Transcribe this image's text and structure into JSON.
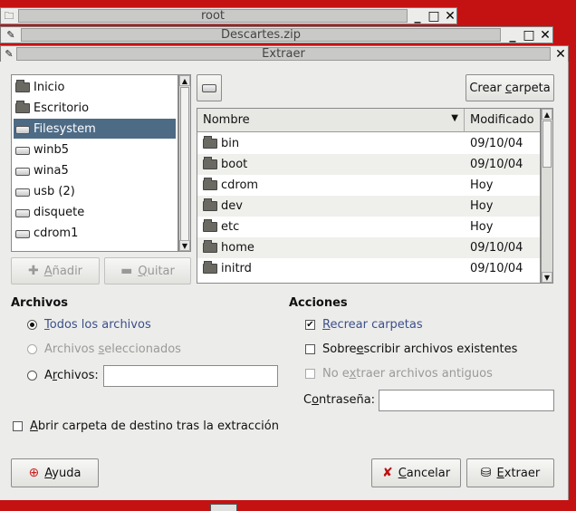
{
  "windows": [
    {
      "icon": "folder-icon",
      "title": "root"
    },
    {
      "icon": "archive-icon",
      "title": "Descartes.zip"
    },
    {
      "icon": "archive-icon",
      "title": "Extraer"
    }
  ],
  "places": {
    "items": [
      {
        "label": "Inicio",
        "icon": "home-folder-icon"
      },
      {
        "label": "Escritorio",
        "icon": "desktop-icon"
      },
      {
        "label": "Filesystem",
        "icon": "drive-icon",
        "selected": true
      },
      {
        "label": "winb5",
        "icon": "drive-icon"
      },
      {
        "label": "wina5",
        "icon": "drive-icon"
      },
      {
        "label": "usb (2)",
        "icon": "drive-icon"
      },
      {
        "label": "disquete",
        "icon": "drive-icon"
      },
      {
        "label": "cdrom1",
        "icon": "drive-icon"
      }
    ],
    "add_label_pre": "",
    "add_label_u": "A",
    "add_label_post": "ñadir",
    "remove_label_pre": "",
    "remove_label_u": "Q",
    "remove_label_post": "uitar"
  },
  "browser": {
    "create_folder_pre": "Crear ",
    "create_folder_u": "c",
    "create_folder_post": "arpeta",
    "columns": {
      "name": "Nombre",
      "modified": "Modificado"
    },
    "rows": [
      {
        "name": "bin",
        "modified": "09/10/04"
      },
      {
        "name": "boot",
        "modified": "09/10/04"
      },
      {
        "name": "cdrom",
        "modified": "Hoy"
      },
      {
        "name": "dev",
        "modified": "Hoy"
      },
      {
        "name": "etc",
        "modified": "Hoy"
      },
      {
        "name": "home",
        "modified": "09/10/04"
      },
      {
        "name": "initrd",
        "modified": "09/10/04"
      }
    ]
  },
  "files": {
    "title": "Archivos",
    "all_pre": "",
    "all_u": "T",
    "all_post": "odos los archivos",
    "selected_pre": "Archivos ",
    "selected_u": "s",
    "selected_post": "eleccionados",
    "pattern_pre": "A",
    "pattern_u": "r",
    "pattern_post": "chivos:",
    "pattern_value": ""
  },
  "actions": {
    "title": "Acciones",
    "recreate_pre": "",
    "recreate_u": "R",
    "recreate_post": "ecrear carpetas",
    "overwrite_pre": "Sobre",
    "overwrite_u": "e",
    "overwrite_post": "scribir archivos existentes",
    "noold_pre": "No e",
    "noold_u": "x",
    "noold_post": "traer archivos antiguos",
    "password_pre": "C",
    "password_u": "o",
    "password_post": "ntraseña:",
    "password_value": ""
  },
  "open_dest_pre": "",
  "open_dest_u": "A",
  "open_dest_post": "brir carpeta de destino tras la extracción",
  "buttons": {
    "help_pre": "",
    "help_u": "A",
    "help_post": "yuda",
    "cancel_pre": "",
    "cancel_u": "C",
    "cancel_post": "ancelar",
    "extract_pre": "",
    "extract_u": "E",
    "extract_post": "xtraer"
  }
}
